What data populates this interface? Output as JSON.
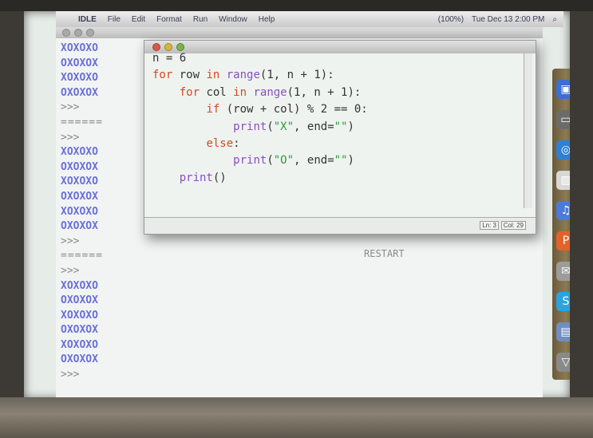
{
  "menubar": {
    "app": "IDLE",
    "menus": [
      "File",
      "Edit",
      "Format",
      "Run",
      "Window",
      "Help"
    ],
    "status_right": [
      "(100%)",
      "Tue Dec 13  2:00 PM"
    ]
  },
  "shell": {
    "output_block_1": [
      "XOXOXO",
      "OXOXOX",
      "XOXOXO",
      "OXOXOX"
    ],
    "prompt": ">>>",
    "rule": "======",
    "output_block_2": [
      "XOXOXO",
      "OXOXOX",
      "XOXOXO",
      "OXOXOX",
      "XOXOXO",
      "OXOXOX"
    ],
    "restart": "RESTART",
    "output_block_3": [
      "XOXOXO",
      "OXOXOX",
      "XOXOXO",
      "OXOXOX",
      "XOXOXO",
      "OXOXOX"
    ]
  },
  "editor": {
    "status": {
      "ln": "Ln: 3",
      "col": "Col: 29"
    }
  },
  "dock": {
    "icons": [
      "finder-icon",
      "terminal-icon",
      "safari-icon",
      "preview-icon",
      "itunes-icon",
      "powerpoint-icon",
      "mail-icon",
      "skype-icon",
      "folder-icon",
      "trash-icon"
    ]
  },
  "colors": {
    "shell_output": "#6a6fd8",
    "keyword": "#d24b1d",
    "builtin": "#8a4fbf",
    "string": "#2d9a37"
  }
}
